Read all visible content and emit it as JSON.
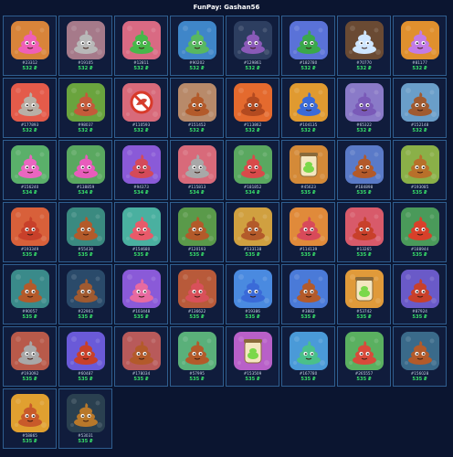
{
  "title": "FunPay: Gashan56",
  "items": [
    {
      "id": "#23312",
      "price": "532 ₽",
      "bg": "#d8843a",
      "body": "#ef5fb8",
      "deco": "face"
    },
    {
      "id": "#19105",
      "price": "532 ₽",
      "bg": "#a67a8a",
      "body": "#b8b8b8",
      "deco": "face"
    },
    {
      "id": "#12811",
      "price": "532 ₽",
      "bg": "#d96a83",
      "body": "#47b84a",
      "deco": "face"
    },
    {
      "id": "#90202",
      "price": "532 ₽",
      "bg": "#3f86c9",
      "body": "#58b860",
      "deco": "face"
    },
    {
      "id": "#129861",
      "price": "532 ₽",
      "bg": "#2d3e60",
      "body": "#8a5ab8",
      "deco": "face"
    },
    {
      "id": "#182780",
      "price": "532 ₽",
      "bg": "#5a72d8",
      "body": "#3aa84a",
      "deco": "face"
    },
    {
      "id": "#70770",
      "price": "532 ₽",
      "bg": "#6a4a33",
      "body": "#cfe6ff",
      "deco": "face"
    },
    {
      "id": "#81177",
      "price": "532 ₽",
      "bg": "#e0902e",
      "body": "#c27be6",
      "deco": "face"
    },
    {
      "id": "#177893",
      "price": "532 ₽",
      "bg": "#e45b4a",
      "body": "#b8b0a6",
      "deco": "face"
    },
    {
      "id": "#98037",
      "price": "532 ₽",
      "bg": "#6aa43e",
      "body": "#c45a3a",
      "deco": "face"
    },
    {
      "id": "#110593",
      "price": "532 ₽",
      "bg": "#d86a7a",
      "body": "#d14434",
      "deco": "ban"
    },
    {
      "id": "#151452",
      "price": "532 ₽",
      "bg": "#b88a6a",
      "body": "#b35a2a",
      "deco": "face"
    },
    {
      "id": "#113862",
      "price": "532 ₽",
      "bg": "#e46a2e",
      "body": "#b34a20",
      "deco": "face"
    },
    {
      "id": "#104135",
      "price": "532 ₽",
      "bg": "#e09a30",
      "body": "#3a6ad8",
      "deco": "face"
    },
    {
      "id": "#65322",
      "price": "532 ₽",
      "bg": "#8a7ac8",
      "body": "#7a5ab8",
      "deco": "face"
    },
    {
      "id": "#152148",
      "price": "532 ₽",
      "bg": "#6a9ec9",
      "body": "#a05a30",
      "deco": "face"
    },
    {
      "id": "#156240",
      "price": "534 ₽",
      "bg": "#5ab06a",
      "body": "#ea66c0",
      "deco": "face"
    },
    {
      "id": "#138859",
      "price": "534 ₽",
      "bg": "#5aa860",
      "body": "#e85cbc",
      "deco": "face"
    },
    {
      "id": "#94373",
      "price": "534 ₽",
      "bg": "#8a5ad8",
      "body": "#d44a5a",
      "deco": "face"
    },
    {
      "id": "#115813",
      "price": "534 ₽",
      "bg": "#d86a7a",
      "body": "#a8a8a8",
      "deco": "face"
    },
    {
      "id": "#181852",
      "price": "534 ₽",
      "bg": "#5aa860",
      "body": "#d84a4a",
      "deco": "face"
    },
    {
      "id": "#45623",
      "price": "535 ₽",
      "bg": "#d48a38",
      "body": "#7ad84a",
      "deco": "jar"
    },
    {
      "id": "#184898",
      "price": "535 ₽",
      "bg": "#5a7ac8",
      "body": "#b35a2a",
      "deco": "face"
    },
    {
      "id": "#193085",
      "price": "535 ₽",
      "bg": "#8ab048",
      "body": "#b8702a",
      "deco": "face"
    },
    {
      "id": "#193349",
      "price": "535 ₽",
      "bg": "#d8603a",
      "body": "#c8402a",
      "deco": "face"
    },
    {
      "id": "#55438",
      "price": "535 ₽",
      "bg": "#3a8a80",
      "body": "#b35a2a",
      "deco": "face"
    },
    {
      "id": "#154680",
      "price": "535 ₽",
      "bg": "#4ab0a0",
      "body": "#e85a6a",
      "deco": "face"
    },
    {
      "id": "#120193",
      "price": "535 ₽",
      "bg": "#5a9a4a",
      "body": "#b35a2a",
      "deco": "face"
    },
    {
      "id": "#133138",
      "price": "535 ₽",
      "bg": "#d0a040",
      "body": "#b35a2a",
      "deco": "face"
    },
    {
      "id": "#114139",
      "price": "535 ₽",
      "bg": "#e08a3a",
      "body": "#d84a5a",
      "deco": "face"
    },
    {
      "id": "#13265",
      "price": "535 ₽",
      "bg": "#d85a6a",
      "body": "#c8402a",
      "deco": "face"
    },
    {
      "id": "#188944",
      "price": "535 ₽",
      "bg": "#4a9a5a",
      "body": "#d8402a",
      "deco": "face"
    },
    {
      "id": "#90057",
      "price": "535 ₽",
      "bg": "#3a8a8a",
      "body": "#b35a2a",
      "deco": "face"
    },
    {
      "id": "#22903",
      "price": "535 ₽",
      "bg": "#2a4a6a",
      "body": "#a05a30",
      "deco": "face"
    },
    {
      "id": "#103448",
      "price": "535 ₽",
      "bg": "#8a5ad8",
      "body": "#e86aa0",
      "deco": "face"
    },
    {
      "id": "#136622",
      "price": "535 ₽",
      "bg": "#b85a3a",
      "body": "#d8505a",
      "deco": "face"
    },
    {
      "id": "#19386",
      "price": "535 ₽",
      "bg": "#4a8ae0",
      "body": "#3a6ad8",
      "deco": "face"
    },
    {
      "id": "#3882",
      "price": "535 ₽",
      "bg": "#4a7ad8",
      "body": "#b35a2a",
      "deco": "face"
    },
    {
      "id": "#53742",
      "price": "535 ₽",
      "bg": "#e09a3a",
      "body": "#7ad84a",
      "deco": "jar"
    },
    {
      "id": "#87924",
      "price": "535 ₽",
      "bg": "#6a5ac8",
      "body": "#c8402a",
      "deco": "face"
    },
    {
      "id": "#193092",
      "price": "535 ₽",
      "bg": "#b85a4a",
      "body": "#a8a8a8",
      "deco": "face"
    },
    {
      "id": "#60487",
      "price": "535 ₽",
      "bg": "#6a5ad8",
      "body": "#c8402a",
      "deco": "face"
    },
    {
      "id": "#178034",
      "price": "535 ₽",
      "bg": "#b85a5a",
      "body": "#b35a2a",
      "deco": "face"
    },
    {
      "id": "#57995",
      "price": "535 ₽",
      "bg": "#5ab07a",
      "body": "#b35a2a",
      "deco": "face"
    },
    {
      "id": "#153509",
      "price": "535 ₽",
      "bg": "#b860c8",
      "body": "#7ad84a",
      "deco": "jar"
    },
    {
      "id": "#167780",
      "price": "535 ₽",
      "bg": "#4a9ad8",
      "body": "#4ac08a",
      "deco": "face"
    },
    {
      "id": "#265557",
      "price": "535 ₽",
      "bg": "#5ab060",
      "body": "#d84a3a",
      "deco": "face"
    },
    {
      "id": "#156028",
      "price": "535 ₽",
      "bg": "#3a6a8a",
      "body": "#b35a2a",
      "deco": "face"
    },
    {
      "id": "#58865",
      "price": "535 ₽",
      "bg": "#e0a030",
      "body": "#c85a2a",
      "deco": "face"
    },
    {
      "id": "#53031",
      "price": "535 ₽",
      "bg": "#2a4050",
      "body": "#b8782a",
      "deco": "face"
    }
  ]
}
